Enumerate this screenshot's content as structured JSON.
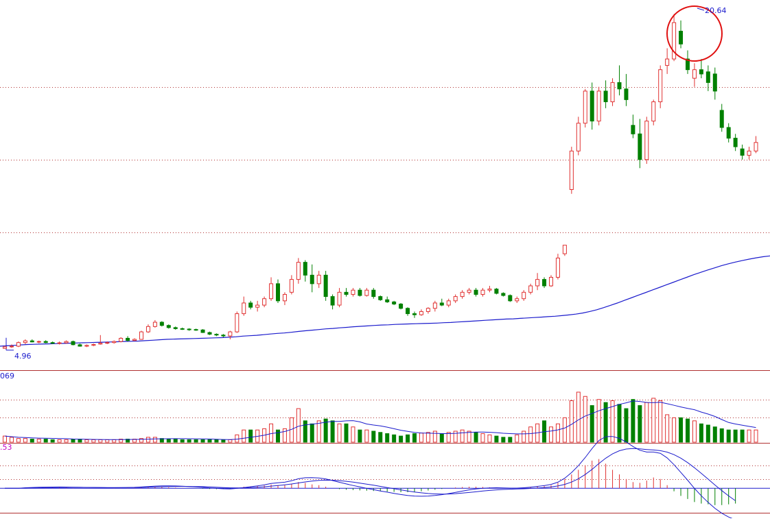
{
  "colors": {
    "up": "#e03030",
    "down": "#008000",
    "ma_line": "#1a1acc",
    "grid": "#b03030",
    "separator": "#b03030",
    "circle": "#e01010",
    "label_blue": "#1a1acc",
    "label_magenta": "#c000c0",
    "background": "#ffffff"
  },
  "chart_data": [
    {
      "type": "candlestick",
      "panel": "price",
      "title": "",
      "annotations": {
        "high_label": "20.64",
        "low_label": "4.96",
        "high_marker": "circle around peak candles"
      },
      "y_range": [
        4.6,
        21.0
      ],
      "gridlines": [
        17.2,
        13.8,
        10.4
      ],
      "ohlc": [
        [
          4.98,
          5.1,
          4.96,
          5.05
        ],
        [
          5.05,
          5.16,
          5.0,
          5.08
        ],
        [
          5.08,
          5.3,
          5.04,
          5.25
        ],
        [
          5.25,
          5.4,
          5.18,
          5.33
        ],
        [
          5.33,
          5.4,
          5.26,
          5.28
        ],
        [
          5.28,
          5.34,
          5.22,
          5.3
        ],
        [
          5.3,
          5.36,
          5.22,
          5.25
        ],
        [
          5.25,
          5.3,
          5.18,
          5.22
        ],
        [
          5.22,
          5.3,
          5.16,
          5.24
        ],
        [
          5.24,
          5.35,
          5.2,
          5.3
        ],
        [
          5.3,
          5.34,
          5.12,
          5.15
        ],
        [
          5.15,
          5.2,
          5.06,
          5.08
        ],
        [
          5.08,
          5.16,
          5.04,
          5.12
        ],
        [
          5.12,
          5.2,
          5.08,
          5.16
        ],
        [
          5.18,
          5.6,
          5.15,
          5.22
        ],
        [
          5.22,
          5.3,
          5.18,
          5.25
        ],
        [
          5.25,
          5.35,
          5.2,
          5.3
        ],
        [
          5.3,
          5.5,
          5.26,
          5.45
        ],
        [
          5.45,
          5.55,
          5.3,
          5.35
        ],
        [
          5.35,
          5.45,
          5.32,
          5.4
        ],
        [
          5.4,
          5.8,
          5.38,
          5.75
        ],
        [
          5.75,
          6.1,
          5.7,
          6.0
        ],
        [
          6.0,
          6.3,
          5.95,
          6.2
        ],
        [
          6.2,
          6.25,
          6.0,
          6.05
        ],
        [
          6.05,
          6.1,
          5.9,
          5.95
        ],
        [
          5.95,
          6.0,
          5.85,
          5.9
        ],
        [
          5.9,
          5.95,
          5.84,
          5.88
        ],
        [
          5.88,
          5.92,
          5.8,
          5.86
        ],
        [
          5.86,
          5.9,
          5.8,
          5.84
        ],
        [
          5.84,
          5.88,
          5.7,
          5.72
        ],
        [
          5.72,
          5.76,
          5.6,
          5.64
        ],
        [
          5.64,
          5.68,
          5.55,
          5.6
        ],
        [
          5.6,
          5.65,
          5.5,
          5.56
        ],
        [
          5.56,
          5.8,
          5.4,
          5.75
        ],
        [
          5.75,
          6.7,
          5.7,
          6.6
        ],
        [
          6.6,
          7.4,
          6.5,
          7.1
        ],
        [
          7.1,
          7.2,
          6.8,
          6.9
        ],
        [
          6.9,
          7.2,
          6.7,
          7.0
        ],
        [
          7.0,
          7.4,
          6.9,
          7.3
        ],
        [
          7.3,
          8.3,
          7.2,
          8.0
        ],
        [
          8.0,
          8.2,
          7.1,
          7.2
        ],
        [
          7.2,
          7.6,
          7.0,
          7.5
        ],
        [
          7.6,
          8.4,
          7.5,
          8.2
        ],
        [
          8.2,
          9.2,
          8.0,
          9.0
        ],
        [
          9.0,
          9.1,
          8.1,
          8.4
        ],
        [
          8.4,
          8.9,
          7.6,
          8.0
        ],
        [
          8.0,
          8.6,
          7.8,
          8.4
        ],
        [
          8.4,
          8.6,
          7.2,
          7.4
        ],
        [
          7.4,
          7.5,
          6.8,
          7.0
        ],
        [
          7.0,
          7.8,
          6.9,
          7.6
        ],
        [
          7.6,
          7.8,
          7.4,
          7.5
        ],
        [
          7.5,
          7.8,
          7.4,
          7.7
        ],
        [
          7.7,
          7.8,
          7.4,
          7.45
        ],
        [
          7.45,
          7.8,
          7.4,
          7.7
        ],
        [
          7.7,
          7.8,
          7.3,
          7.4
        ],
        [
          7.4,
          7.45,
          7.2,
          7.25
        ],
        [
          7.25,
          7.4,
          7.1,
          7.15
        ],
        [
          7.15,
          7.2,
          7.0,
          7.05
        ],
        [
          7.05,
          7.1,
          6.8,
          6.85
        ],
        [
          6.85,
          6.9,
          6.5,
          6.6
        ],
        [
          6.6,
          6.7,
          6.4,
          6.55
        ],
        [
          6.55,
          6.8,
          6.5,
          6.7
        ],
        [
          6.7,
          6.9,
          6.6,
          6.85
        ],
        [
          6.85,
          7.2,
          6.7,
          7.1
        ],
        [
          7.1,
          7.3,
          6.95,
          7.0
        ],
        [
          7.0,
          7.3,
          6.9,
          7.2
        ],
        [
          7.2,
          7.5,
          7.1,
          7.4
        ],
        [
          7.4,
          7.7,
          7.3,
          7.6
        ],
        [
          7.6,
          7.8,
          7.5,
          7.7
        ],
        [
          7.7,
          7.8,
          7.4,
          7.5
        ],
        [
          7.5,
          7.8,
          7.4,
          7.7
        ],
        [
          7.7,
          7.9,
          7.6,
          7.75
        ],
        [
          7.75,
          7.8,
          7.5,
          7.55
        ],
        [
          7.55,
          7.6,
          7.4,
          7.45
        ],
        [
          7.45,
          7.5,
          7.15,
          7.2
        ],
        [
          7.2,
          7.4,
          7.1,
          7.3
        ],
        [
          7.3,
          7.7,
          7.2,
          7.6
        ],
        [
          7.6,
          8.0,
          7.5,
          7.9
        ],
        [
          7.9,
          8.5,
          7.7,
          8.2
        ],
        [
          8.2,
          8.3,
          7.8,
          7.9
        ],
        [
          7.9,
          8.4,
          7.85,
          8.3
        ],
        [
          8.3,
          9.4,
          8.2,
          9.2
        ],
        [
          9.4,
          9.8,
          9.3,
          9.8
        ],
        [
          12.4,
          14.4,
          12.2,
          14.2
        ],
        [
          14.2,
          15.8,
          14.0,
          15.5
        ],
        [
          15.5,
          17.1,
          15.3,
          17.0
        ],
        [
          17.0,
          17.4,
          15.2,
          15.6
        ],
        [
          15.6,
          17.2,
          15.4,
          17.0
        ],
        [
          17.0,
          17.5,
          16.2,
          16.5
        ],
        [
          16.5,
          17.6,
          16.3,
          17.4
        ],
        [
          17.4,
          18.2,
          16.8,
          17.1
        ],
        [
          17.1,
          17.8,
          16.3,
          16.6
        ],
        [
          15.4,
          15.9,
          14.8,
          15.0
        ],
        [
          15.0,
          15.7,
          13.4,
          13.8
        ],
        [
          13.8,
          15.8,
          13.6,
          15.6
        ],
        [
          15.6,
          16.6,
          15.4,
          16.5
        ],
        [
          16.5,
          18.2,
          16.2,
          18.0
        ],
        [
          18.2,
          19.0,
          17.8,
          18.5
        ],
        [
          18.5,
          20.6,
          18.4,
          20.2
        ],
        [
          19.8,
          20.3,
          19.0,
          19.2
        ],
        [
          18.5,
          18.9,
          17.8,
          18.0
        ],
        [
          17.6,
          18.3,
          17.2,
          18.0
        ],
        [
          18.0,
          18.5,
          17.6,
          17.8
        ],
        [
          17.9,
          18.2,
          17.0,
          17.4
        ],
        [
          17.8,
          18.1,
          16.6,
          17.0
        ],
        [
          16.1,
          16.4,
          15.1,
          15.3
        ],
        [
          15.3,
          15.5,
          14.6,
          14.8
        ],
        [
          14.8,
          15.0,
          14.2,
          14.4
        ],
        [
          14.3,
          14.5,
          13.8,
          14.0
        ],
        [
          14.0,
          14.4,
          13.8,
          14.2
        ],
        [
          14.2,
          14.9,
          14.1,
          14.6
        ]
      ],
      "moving_average": [
        5.08,
        5.1,
        5.12,
        5.14,
        5.16,
        5.17,
        5.18,
        5.19,
        5.2,
        5.21,
        5.22,
        5.23,
        5.24,
        5.25,
        5.26,
        5.27,
        5.28,
        5.29,
        5.3,
        5.31,
        5.32,
        5.34,
        5.36,
        5.38,
        5.4,
        5.41,
        5.42,
        5.43,
        5.44,
        5.45,
        5.46,
        5.47,
        5.48,
        5.5,
        5.52,
        5.55,
        5.57,
        5.59,
        5.62,
        5.65,
        5.68,
        5.7,
        5.73,
        5.77,
        5.8,
        5.83,
        5.86,
        5.89,
        5.91,
        5.94,
        5.96,
        5.99,
        6.01,
        6.03,
        6.05,
        6.07,
        6.08,
        6.1,
        6.11,
        6.12,
        6.13,
        6.14,
        6.15,
        6.16,
        6.18,
        6.19,
        6.21,
        6.23,
        6.25,
        6.27,
        6.29,
        6.31,
        6.33,
        6.35,
        6.36,
        6.38,
        6.4,
        6.42,
        6.44,
        6.46,
        6.48,
        6.51,
        6.54,
        6.58,
        6.63,
        6.7,
        6.78,
        6.88,
        6.99,
        7.1,
        7.22,
        7.34,
        7.46,
        7.58,
        7.7,
        7.82,
        7.94,
        8.06,
        8.18,
        8.3,
        8.42,
        8.53,
        8.64,
        8.74,
        8.84,
        8.93,
        9.01,
        9.08,
        9.15,
        9.21,
        9.26,
        9.3
      ]
    },
    {
      "type": "bar",
      "panel": "volume",
      "title": "",
      "label": "069",
      "y_range": [
        0,
        100
      ],
      "gridlines": [
        70,
        40
      ],
      "values": [
        10,
        10,
        7,
        7,
        6,
        6,
        6,
        6,
        5,
        5,
        4,
        4,
        4,
        4,
        4,
        4,
        4,
        4,
        4,
        4,
        4,
        4,
        4,
        4,
        4,
        4,
        4,
        4,
        4,
        4,
        4,
        4,
        4,
        4,
        4,
        4,
        4,
        4,
        4,
        4,
        5,
        5,
        5,
        5,
        5,
        5,
        5,
        5,
        5,
        5,
        4,
        4,
        4,
        4,
        4,
        4,
        4,
        4,
        4,
        4,
        4,
        4,
        4,
        4,
        5,
        4,
        4,
        4,
        4,
        4,
        4,
        4,
        4,
        4,
        4,
        5,
        5,
        5,
        5,
        5,
        5,
        5,
        5,
        5,
        5,
        5,
        5,
        5,
        5,
        5,
        5,
        5,
        5,
        5,
        5,
        5,
        5,
        5,
        5,
        5,
        5,
        5,
        5,
        5,
        5,
        5,
        5,
        5,
        5,
        5,
        5,
        5
      ],
      "candles_volume": [
        10,
        8,
        6,
        6,
        5,
        5,
        5,
        4,
        4,
        4,
        5,
        5,
        4,
        4,
        4,
        4,
        4,
        5,
        5,
        5,
        6,
        8,
        8,
        6,
        5,
        5,
        4,
        4,
        4,
        4,
        4,
        4,
        4,
        4,
        12,
        20,
        20,
        20,
        22,
        30,
        20,
        22,
        40,
        55,
        35,
        30,
        35,
        38,
        35,
        30,
        30,
        25,
        20,
        20,
        18,
        16,
        14,
        12,
        10,
        12,
        14,
        15,
        16,
        18,
        14,
        16,
        18,
        20,
        18,
        16,
        14,
        12,
        10,
        8,
        8,
        12,
        18,
        25,
        30,
        35,
        25,
        30,
        40,
        68,
        82,
        75,
        60,
        70,
        65,
        68,
        62,
        55,
        70,
        60,
        65,
        72,
        68,
        45,
        40,
        40,
        38,
        35,
        30,
        28,
        25,
        22,
        20,
        20,
        20,
        20,
        20,
        20
      ]
    },
    {
      "type": "bar",
      "panel": "macd",
      "title": "",
      "label": ".53",
      "y_range": [
        -1.6,
        2.6
      ],
      "gridlines": [
        1.5,
        0.6
      ],
      "hist": [
        0.0,
        0.0,
        0.0,
        0.05,
        0.05,
        0.05,
        0.04,
        0.03,
        0.03,
        0.02,
        0.01,
        0.0,
        0.0,
        0.0,
        0.0,
        0.0,
        0.01,
        0.02,
        0.03,
        0.04,
        0.06,
        0.08,
        0.09,
        0.08,
        0.06,
        0.04,
        0.02,
        0.0,
        -0.01,
        -0.03,
        -0.05,
        -0.06,
        -0.06,
        -0.04,
        0.04,
        0.1,
        0.12,
        0.14,
        0.18,
        0.24,
        0.2,
        0.2,
        0.3,
        0.4,
        0.35,
        0.25,
        0.2,
        0.1,
        0.0,
        -0.06,
        -0.1,
        -0.12,
        -0.14,
        -0.16,
        -0.18,
        -0.2,
        -0.22,
        -0.24,
        -0.26,
        -0.26,
        -0.24,
        -0.2,
        -0.15,
        -0.1,
        -0.05,
        0.0,
        0.05,
        0.08,
        0.1,
        0.1,
        0.08,
        0.06,
        0.03,
        0.0,
        -0.02,
        0.0,
        0.04,
        0.08,
        0.12,
        0.14,
        0.2,
        0.35,
        0.6,
        0.9,
        1.2,
        1.5,
        1.8,
        1.9,
        1.6,
        1.2,
        0.9,
        0.6,
        0.4,
        0.35,
        0.5,
        0.7,
        0.6,
        0.2,
        -0.2,
        -0.5,
        -0.7,
        -0.9,
        -1.0,
        -1.05,
        -1.1,
        -1.1,
        -1.05,
        -1.0
      ]
    }
  ]
}
